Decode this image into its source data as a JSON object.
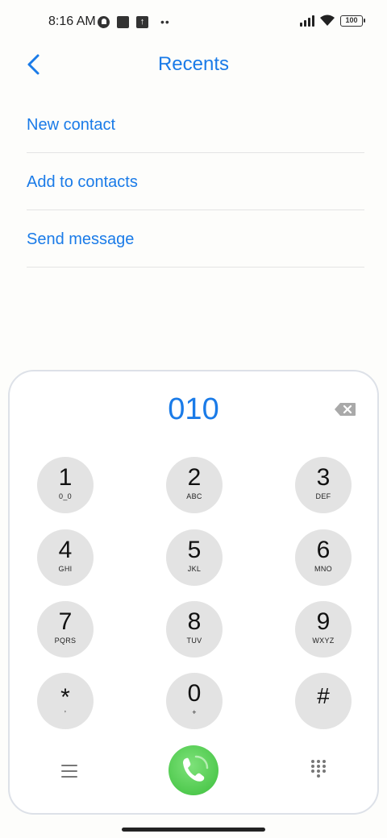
{
  "status_bar": {
    "time": "8:16 AM",
    "battery": "100",
    "icons": [
      "notification-circle-icon",
      "app-square-icon",
      "upload-icon",
      "more-dots-icon",
      "signal-icon",
      "wifi-icon",
      "battery-icon"
    ]
  },
  "header": {
    "title": "Recents",
    "back_icon": "chevron-left-icon"
  },
  "actions": [
    {
      "label": "New contact"
    },
    {
      "label": "Add to contacts"
    },
    {
      "label": "Send message"
    }
  ],
  "dialpad": {
    "number": "010",
    "keys": [
      {
        "digit": "1",
        "sub": "0_0"
      },
      {
        "digit": "2",
        "sub": "ABC"
      },
      {
        "digit": "3",
        "sub": "DEF"
      },
      {
        "digit": "4",
        "sub": "GHI"
      },
      {
        "digit": "5",
        "sub": "JKL"
      },
      {
        "digit": "6",
        "sub": "MNO"
      },
      {
        "digit": "7",
        "sub": "PQRS"
      },
      {
        "digit": "8",
        "sub": "TUV"
      },
      {
        "digit": "9",
        "sub": "WXYZ"
      },
      {
        "digit": "*",
        "sub": ","
      },
      {
        "digit": "0",
        "sub": "+"
      },
      {
        "digit": "#",
        "sub": ""
      }
    ]
  },
  "colors": {
    "accent": "#1a7be8",
    "call_green": "#4cc84a",
    "key_bg": "#e3e3e3"
  }
}
